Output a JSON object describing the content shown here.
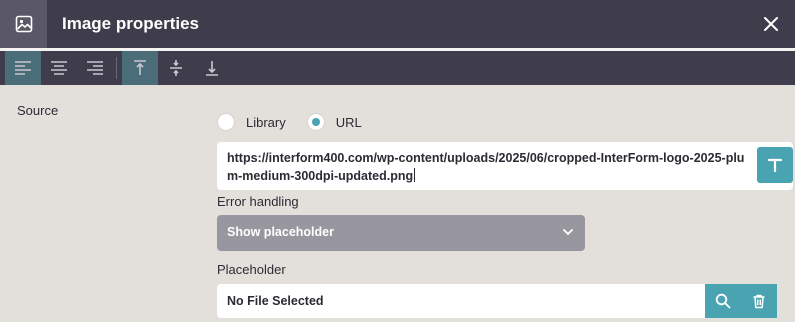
{
  "dialog": {
    "title": "Image properties",
    "icons": {
      "app": "image-icon",
      "close": "close-icon"
    }
  },
  "toolbar": {
    "buttons": [
      {
        "name": "align-left-icon",
        "active": true
      },
      {
        "name": "align-center-icon",
        "active": false
      },
      {
        "name": "align-right-icon",
        "active": false
      },
      {
        "name": "align-top-icon",
        "active": true
      },
      {
        "name": "align-middle-icon",
        "active": false
      },
      {
        "name": "align-bottom-icon",
        "active": false
      }
    ]
  },
  "source": {
    "label": "Source",
    "options": [
      {
        "label": "Library",
        "selected": false
      },
      {
        "label": "URL",
        "selected": true
      }
    ],
    "url_value": "https://interform400.com/wp-content/uploads/2025/06/cropped-InterForm-logo-2025-plum-medium-300dpi-updated.png",
    "url_button_icon": "text-icon"
  },
  "error_handling": {
    "label": "Error handling",
    "selected": "Show placeholder"
  },
  "placeholder": {
    "label": "Placeholder",
    "value": "No File Selected",
    "buttons": [
      "search-icon",
      "trash-icon"
    ]
  },
  "colors": {
    "titlebar": "#3f3d4b",
    "accent": "#4aa3b0",
    "background": "#e3e0dc",
    "select": "#98969f"
  }
}
